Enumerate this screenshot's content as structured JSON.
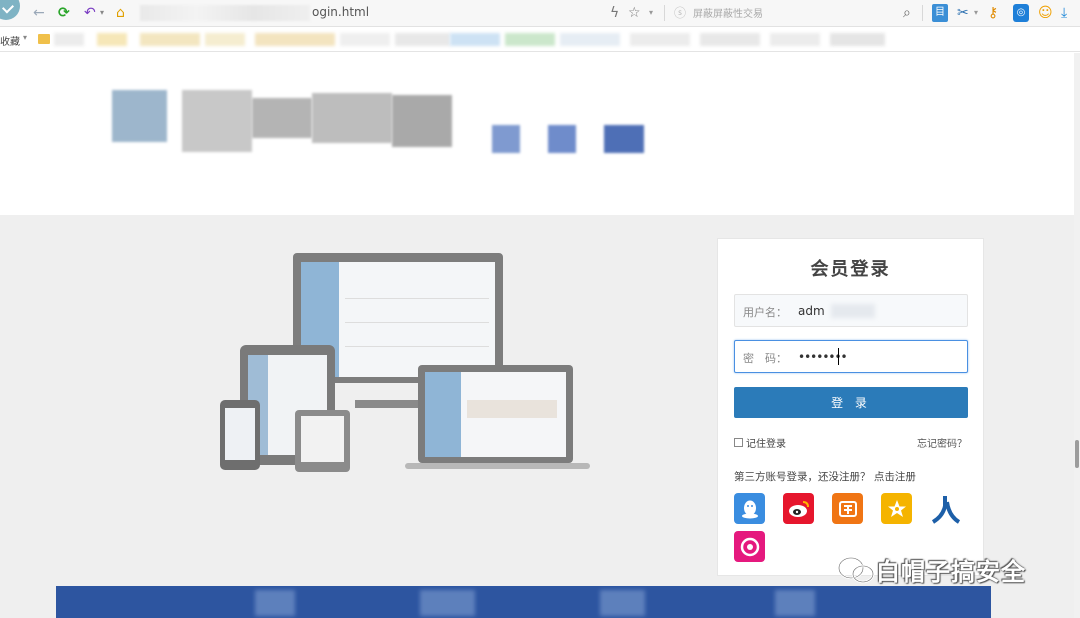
{
  "browser": {
    "url_suffix": "ogin.html",
    "search_hint": "屏蔽屏蔽性交易",
    "bookmark_label": "收藏"
  },
  "login": {
    "title": "会员登录",
    "username_label": "用户名：",
    "username_value": "adm",
    "password_label": "密　码：",
    "password_value": "••••••••",
    "submit_label": "登 录",
    "remember_label": "记住登录",
    "forgot_label": "忘记密码？",
    "third_party_text": "第三方账号登录，还没注册？",
    "register_label": "点击注册"
  },
  "social_logins": [
    {
      "name": "qq",
      "color": "#3a8de0"
    },
    {
      "name": "weibo",
      "color": "#e6162d"
    },
    {
      "name": "taobao",
      "color": "#f07514"
    },
    {
      "name": "kaixin",
      "color": "#f5b400"
    },
    {
      "name": "renren",
      "color": "#1d5fa8"
    },
    {
      "name": "other",
      "color": "#e5197e"
    }
  ],
  "watermark": {
    "text": "白帽子搞安全"
  }
}
